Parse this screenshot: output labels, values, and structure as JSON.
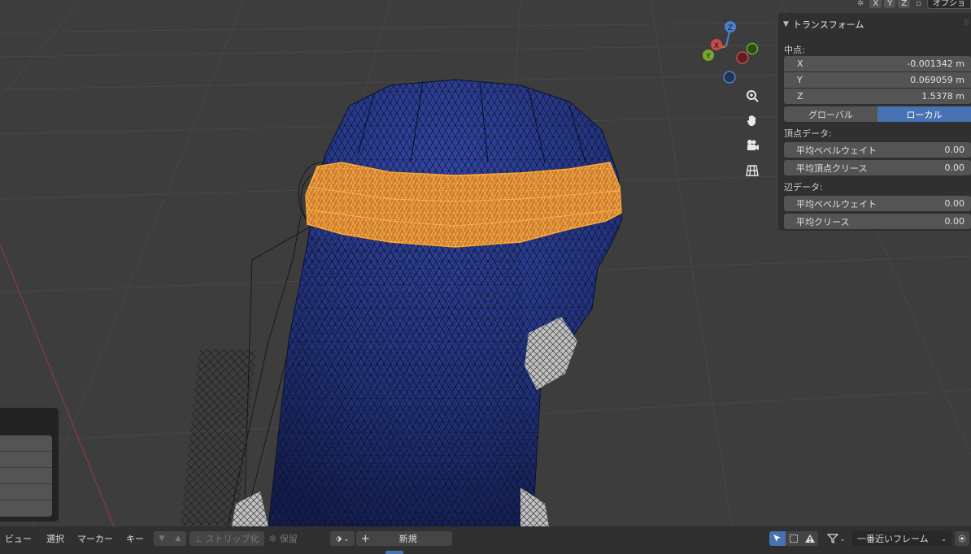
{
  "header": {
    "axis_buttons": [
      "X",
      "Y",
      "Z"
    ],
    "options_label": "オプショ"
  },
  "gizmo": {
    "z_label": "Z",
    "x_label": "X",
    "y_label": "Y"
  },
  "n_panel": {
    "section_title": "トランスフォーム",
    "median_label": "中点:",
    "median": [
      {
        "axis": "X",
        "value": "-0.001342 m"
      },
      {
        "axis": "Y",
        "value": "0.069059 m"
      },
      {
        "axis": "Z",
        "value": "1.5378 m"
      }
    ],
    "space_global": "グローバル",
    "space_local": "ローカル",
    "vertex_data_label": "頂点データ:",
    "vertex_bevel_label": "平均ベベルウェイト",
    "vertex_bevel_value": "0.00",
    "vertex_crease_label": "平均頂点クリース",
    "vertex_crease_value": "0.00",
    "edge_data_label": "辺データ:",
    "edge_bevel_label": "平均ベベルウェイト",
    "edge_bevel_value": "0.00",
    "edge_crease_label": "平均クリース",
    "edge_crease_value": "0.00"
  },
  "timeline": {
    "menus": [
      "ビュー",
      "選択",
      "マーカー",
      "キー"
    ],
    "strip_label": "ストリップ化",
    "keep_label": "保留",
    "new_label": "新規",
    "snap_label": "一番近いフレーム"
  },
  "colors": {
    "accent": "#4772b3",
    "selection": "#ff9f1a",
    "hair": "#1c2a6e"
  }
}
